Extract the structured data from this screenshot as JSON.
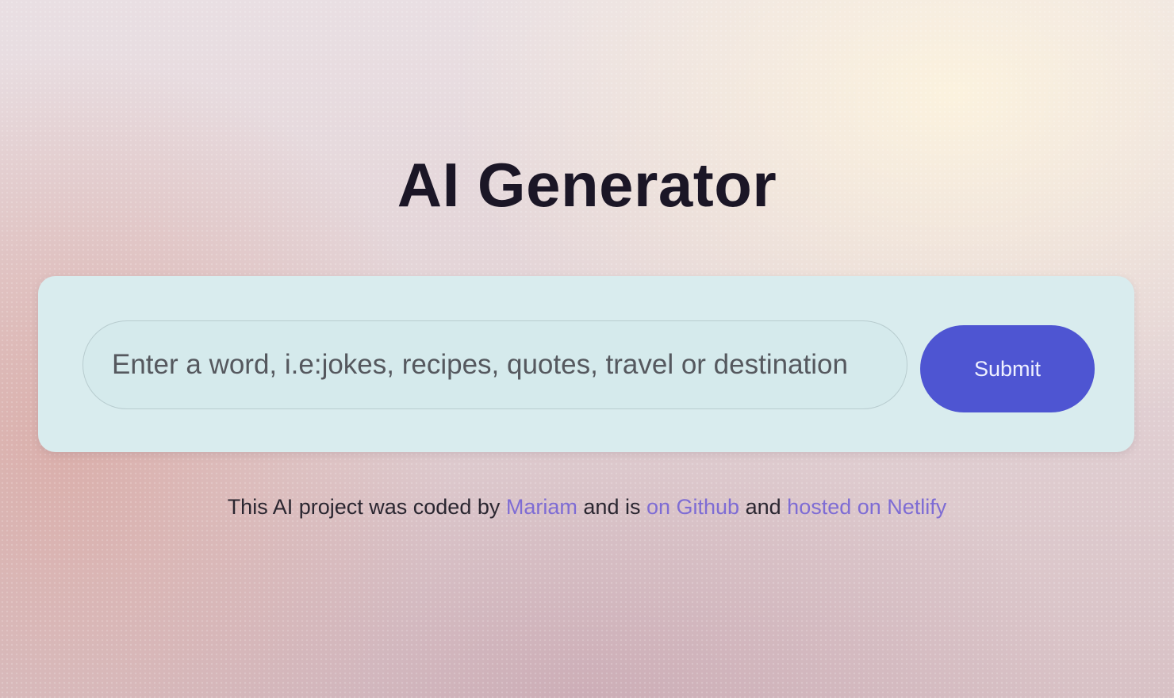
{
  "page": {
    "title": "AI Generator"
  },
  "form": {
    "input_placeholder": "Enter a word, i.e:jokes, recipes, quotes, travel or destination",
    "input_value": "",
    "submit_label": "Submit"
  },
  "footer": {
    "text_1": "This AI project was coded by",
    "link_author": "Mariam",
    "text_2": "and is",
    "link_github": "on Github",
    "text_3": "and",
    "link_netlify": "hosted on Netlify"
  },
  "colors": {
    "accent": "#4e55d2",
    "link": "#7e6cd4",
    "card_background": "#d9ecee",
    "title_text": "#1b1626"
  }
}
